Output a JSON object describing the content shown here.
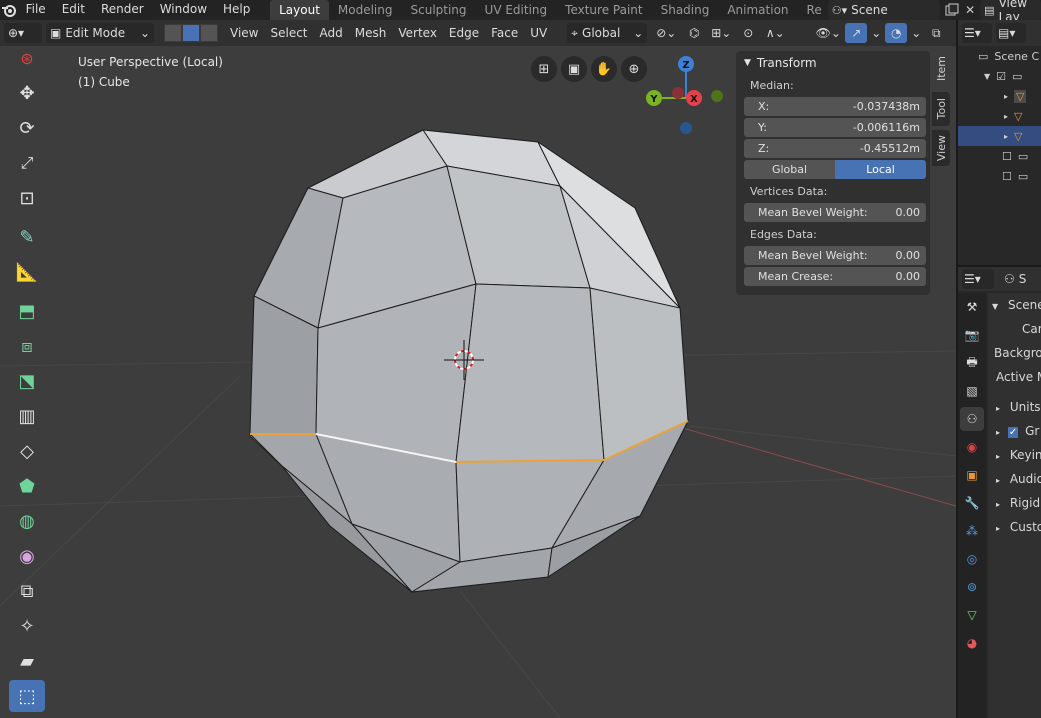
{
  "topbar": {
    "menus": [
      "File",
      "Edit",
      "Render",
      "Window",
      "Help"
    ],
    "workspaces": [
      {
        "label": "Layout",
        "active": true
      },
      {
        "label": "Modeling",
        "active": false
      },
      {
        "label": "Sculpting",
        "active": false
      },
      {
        "label": "UV Editing",
        "active": false
      },
      {
        "label": "Texture Paint",
        "active": false
      },
      {
        "label": "Shading",
        "active": false
      },
      {
        "label": "Animation",
        "active": false
      },
      {
        "label": "Re",
        "active": false
      }
    ],
    "scene_name": "Scene",
    "view_layer": "View Lay"
  },
  "viewport_header": {
    "mode": "Edit Mode",
    "menus": [
      "View",
      "Select",
      "Add",
      "Mesh",
      "Vertex",
      "Edge",
      "Face",
      "UV"
    ],
    "transform_orientation": "Global"
  },
  "viewport": {
    "perspective_label": "User Perspective (Local)",
    "object_label": "(1) Cube",
    "gizmo_axes": {
      "x": "X",
      "y": "Y",
      "z": "Z"
    },
    "colors": {
      "background": "#3d3d3d",
      "mesh": "#b9bcc0",
      "selected_edge": "#e8a33a",
      "active_edge": "#ffffff",
      "x_axis": "#e6414a",
      "y_axis": "#7cb321",
      "z_axis": "#3b82d6"
    }
  },
  "npanel": {
    "title": "Transform",
    "median_label": "Median:",
    "median": [
      {
        "axis": "X:",
        "value": "-0.037438m"
      },
      {
        "axis": "Y:",
        "value": "-0.006116m"
      },
      {
        "axis": "Z:",
        "value": "-0.45512m"
      }
    ],
    "space_toggle": {
      "global": "Global",
      "local": "Local",
      "selected": "Local"
    },
    "vertices_label": "Vertices Data:",
    "vertex_fields": [
      {
        "label": "Mean Bevel Weight:",
        "value": "0.00"
      }
    ],
    "edges_label": "Edges Data:",
    "edge_fields": [
      {
        "label": "Mean Bevel Weight:",
        "value": "0.00"
      },
      {
        "label": "Mean Crease:",
        "value": "0.00"
      }
    ],
    "tabs": [
      "Item",
      "Tool",
      "View"
    ],
    "active_tab": "Item"
  },
  "outliner": {
    "root": "Scene C"
  },
  "properties": {
    "header_label": "S",
    "section": "Scene",
    "rows": [
      "Can",
      "Backgrou",
      "Active M"
    ],
    "panels": [
      "Units",
      "Gr",
      "Keying",
      "Audio",
      "Rigid B",
      "Custom"
    ]
  }
}
